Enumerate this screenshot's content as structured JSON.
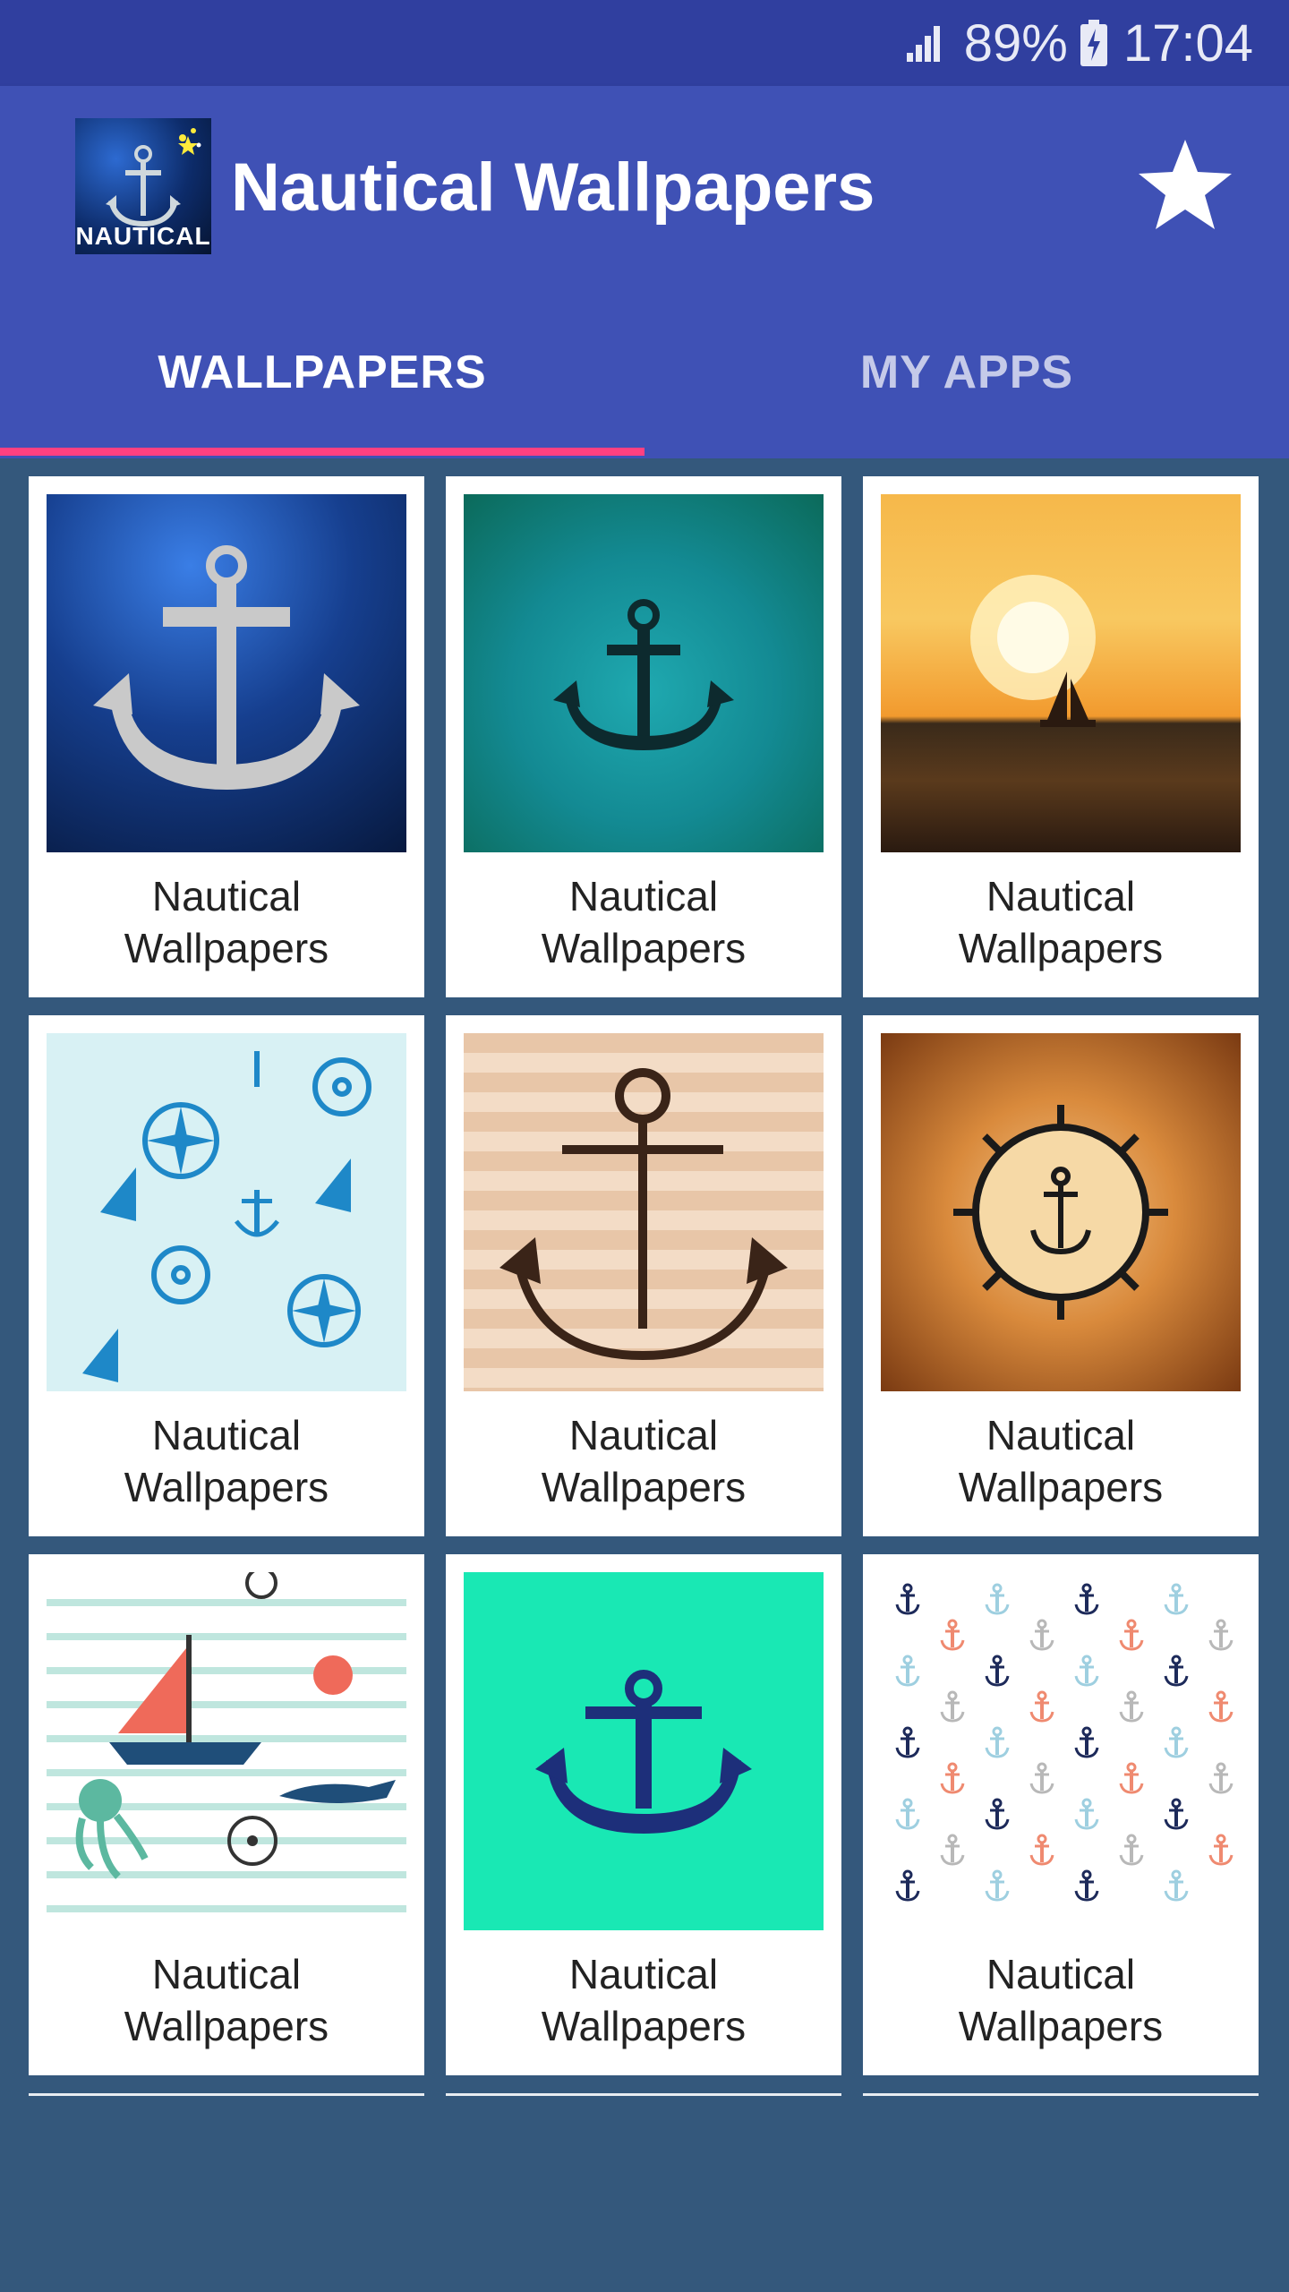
{
  "status_bar": {
    "battery_percent": "89%",
    "time": "17:04"
  },
  "app_bar": {
    "icon_label": "NAUTICAL",
    "title": "Nautical Wallpapers",
    "star_icon": "star-icon"
  },
  "tabs": [
    {
      "label": "WALLPAPERS",
      "selected": true
    },
    {
      "label": "MY APPS",
      "selected": false
    }
  ],
  "colors": {
    "status_bar": "#303f9f",
    "app_bar": "#3f51b5",
    "tab_indicator": "#ff4081",
    "background": "#34587c"
  },
  "wallpapers": [
    {
      "line1": "Nautical",
      "line2": "Wallpapers",
      "image": "silver anchor on blue glitter"
    },
    {
      "line1": "Nautical",
      "line2": "Wallpapers",
      "image": "black anchor on teal"
    },
    {
      "line1": "Nautical",
      "line2": "Wallpapers",
      "image": "sailboat at sunset"
    },
    {
      "line1": "Nautical",
      "line2": "Wallpapers",
      "image": "blue nautical pattern"
    },
    {
      "line1": "Nautical",
      "line2": "Wallpapers",
      "image": "sketched anchor on stripes"
    },
    {
      "line1": "Nautical",
      "line2": "Wallpapers",
      "image": "anchor in ship wheel on wood"
    },
    {
      "line1": "Nautical",
      "line2": "Wallpapers",
      "image": "sailboat and waves pattern"
    },
    {
      "line1": "Nautical",
      "line2": "Wallpapers",
      "image": "navy anchor on mint"
    },
    {
      "line1": "Nautical",
      "line2": "Wallpapers",
      "image": "multicolor anchor pattern"
    }
  ]
}
